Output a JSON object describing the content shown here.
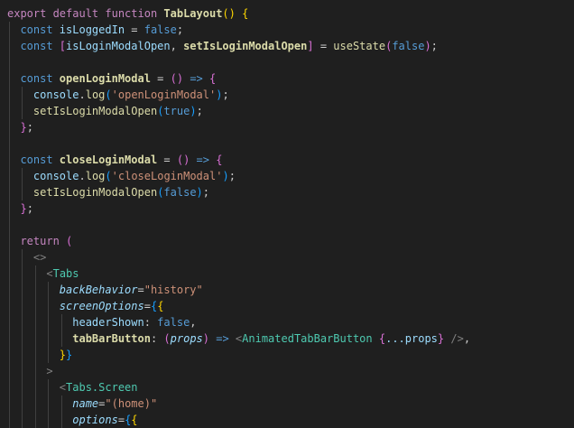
{
  "editor": {
    "theme_colors": {
      "background": "#1f1f1f",
      "keyword": "#569cd6",
      "control": "#c586c0",
      "variable": "#9cdcfe",
      "function": "#dcdcaa",
      "string": "#ce9178",
      "component": "#4ec9b0",
      "bracket_1": "#ffd700",
      "bracket_2": "#da70d6",
      "bracket_3": "#179fff"
    },
    "lines": [
      {
        "tokens": [
          {
            "t": "export default function ",
            "c": "ctl"
          },
          {
            "t": "TabLayout",
            "c": "fn bold"
          },
          {
            "t": "() ",
            "c": "br1"
          },
          {
            "t": "{",
            "c": "br1"
          }
        ]
      },
      {
        "tokens": [
          {
            "t": "  const ",
            "c": "kw"
          },
          {
            "t": "isLoggedIn",
            "c": "var"
          },
          {
            "t": " = ",
            "c": "pn"
          },
          {
            "t": "false",
            "c": "kw"
          },
          {
            "t": ";",
            "c": "pn"
          }
        ]
      },
      {
        "tokens": [
          {
            "t": "  const ",
            "c": "kw"
          },
          {
            "t": "[",
            "c": "br2"
          },
          {
            "t": "isLoginModalOpen",
            "c": "var"
          },
          {
            "t": ", ",
            "c": "pn"
          },
          {
            "t": "setIsLoginModalOpen",
            "c": "fn bold"
          },
          {
            "t": "]",
            "c": "br2"
          },
          {
            "t": " = ",
            "c": "pn"
          },
          {
            "t": "useState",
            "c": "fn"
          },
          {
            "t": "(",
            "c": "br2"
          },
          {
            "t": "false",
            "c": "kw"
          },
          {
            "t": ")",
            "c": "br2"
          },
          {
            "t": ";",
            "c": "pn"
          }
        ]
      },
      {
        "tokens": []
      },
      {
        "tokens": [
          {
            "t": "  const ",
            "c": "kw"
          },
          {
            "t": "openLoginModal",
            "c": "fn bold"
          },
          {
            "t": " = ",
            "c": "pn"
          },
          {
            "t": "()",
            "c": "br2"
          },
          {
            "t": " => ",
            "c": "kw"
          },
          {
            "t": "{",
            "c": "br2"
          }
        ]
      },
      {
        "tokens": [
          {
            "t": "    console",
            "c": "var"
          },
          {
            "t": ".",
            "c": "pn"
          },
          {
            "t": "log",
            "c": "fn"
          },
          {
            "t": "(",
            "c": "br3"
          },
          {
            "t": "'openLoginModal'",
            "c": "str"
          },
          {
            "t": ")",
            "c": "br3"
          },
          {
            "t": ";",
            "c": "pn"
          }
        ]
      },
      {
        "tokens": [
          {
            "t": "    ",
            "c": "pn"
          },
          {
            "t": "setIsLoginModalOpen",
            "c": "fn"
          },
          {
            "t": "(",
            "c": "br3"
          },
          {
            "t": "true",
            "c": "kw"
          },
          {
            "t": ")",
            "c": "br3"
          },
          {
            "t": ";",
            "c": "pn"
          }
        ]
      },
      {
        "tokens": [
          {
            "t": "  ",
            "c": "pn"
          },
          {
            "t": "}",
            "c": "br2"
          },
          {
            "t": ";",
            "c": "pn"
          }
        ]
      },
      {
        "tokens": []
      },
      {
        "tokens": [
          {
            "t": "  const ",
            "c": "kw"
          },
          {
            "t": "closeLoginModal",
            "c": "fn bold"
          },
          {
            "t": " = ",
            "c": "pn"
          },
          {
            "t": "()",
            "c": "br2"
          },
          {
            "t": " => ",
            "c": "kw"
          },
          {
            "t": "{",
            "c": "br2"
          }
        ]
      },
      {
        "tokens": [
          {
            "t": "    console",
            "c": "var"
          },
          {
            "t": ".",
            "c": "pn"
          },
          {
            "t": "log",
            "c": "fn"
          },
          {
            "t": "(",
            "c": "br3"
          },
          {
            "t": "'closeLoginModal'",
            "c": "str"
          },
          {
            "t": ")",
            "c": "br3"
          },
          {
            "t": ";",
            "c": "pn"
          }
        ]
      },
      {
        "tokens": [
          {
            "t": "    ",
            "c": "pn"
          },
          {
            "t": "setIsLoginModalOpen",
            "c": "fn"
          },
          {
            "t": "(",
            "c": "br3"
          },
          {
            "t": "false",
            "c": "kw"
          },
          {
            "t": ")",
            "c": "br3"
          },
          {
            "t": ";",
            "c": "pn"
          }
        ]
      },
      {
        "tokens": [
          {
            "t": "  ",
            "c": "pn"
          },
          {
            "t": "}",
            "c": "br2"
          },
          {
            "t": ";",
            "c": "pn"
          }
        ]
      },
      {
        "tokens": []
      },
      {
        "tokens": [
          {
            "t": "  return ",
            "c": "ctl"
          },
          {
            "t": "(",
            "c": "br2"
          }
        ]
      },
      {
        "tokens": [
          {
            "t": "    ",
            "c": "pn"
          },
          {
            "t": "<>",
            "c": "tag"
          }
        ]
      },
      {
        "tokens": [
          {
            "t": "      ",
            "c": "pn"
          },
          {
            "t": "<",
            "c": "tag"
          },
          {
            "t": "Tabs",
            "c": "tagn"
          }
        ]
      },
      {
        "tokens": [
          {
            "t": "        ",
            "c": "pn"
          },
          {
            "t": "backBehavior",
            "c": "attr"
          },
          {
            "t": "=",
            "c": "pn"
          },
          {
            "t": "\"history\"",
            "c": "str"
          }
        ]
      },
      {
        "tokens": [
          {
            "t": "        ",
            "c": "pn"
          },
          {
            "t": "screenOptions",
            "c": "attr"
          },
          {
            "t": "=",
            "c": "pn"
          },
          {
            "t": "{",
            "c": "br3"
          },
          {
            "t": "{",
            "c": "br1"
          }
        ]
      },
      {
        "tokens": [
          {
            "t": "          headerShown",
            "c": "var"
          },
          {
            "t": ": ",
            "c": "pn"
          },
          {
            "t": "false",
            "c": "kw"
          },
          {
            "t": ",",
            "c": "pn"
          }
        ]
      },
      {
        "tokens": [
          {
            "t": "          tabBarButton",
            "c": "fn bold"
          },
          {
            "t": ": ",
            "c": "pn"
          },
          {
            "t": "(",
            "c": "br2"
          },
          {
            "t": "props",
            "c": "var ital"
          },
          {
            "t": ")",
            "c": "br2"
          },
          {
            "t": " => ",
            "c": "kw"
          },
          {
            "t": "<",
            "c": "tag"
          },
          {
            "t": "AnimatedTabBarButton",
            "c": "tagn"
          },
          {
            "t": " ",
            "c": "pn"
          },
          {
            "t": "{",
            "c": "br2"
          },
          {
            "t": "...props",
            "c": "var"
          },
          {
            "t": "}",
            "c": "br2"
          },
          {
            "t": " />",
            "c": "tag"
          },
          {
            "t": ",",
            "c": "pn"
          }
        ]
      },
      {
        "tokens": [
          {
            "t": "        ",
            "c": "pn"
          },
          {
            "t": "}",
            "c": "br1"
          },
          {
            "t": "}",
            "c": "br3"
          }
        ]
      },
      {
        "tokens": [
          {
            "t": "      ",
            "c": "pn"
          },
          {
            "t": ">",
            "c": "tag"
          }
        ]
      },
      {
        "tokens": [
          {
            "t": "        ",
            "c": "pn"
          },
          {
            "t": "<",
            "c": "tag"
          },
          {
            "t": "Tabs.Screen",
            "c": "tagn"
          }
        ]
      },
      {
        "tokens": [
          {
            "t": "          ",
            "c": "pn"
          },
          {
            "t": "name",
            "c": "attr"
          },
          {
            "t": "=",
            "c": "pn"
          },
          {
            "t": "\"(home)\"",
            "c": "str"
          }
        ]
      },
      {
        "tokens": [
          {
            "t": "          ",
            "c": "pn"
          },
          {
            "t": "options",
            "c": "attr"
          },
          {
            "t": "=",
            "c": "pn"
          },
          {
            "t": "{",
            "c": "br3"
          },
          {
            "t": "{",
            "c": "br1"
          }
        ]
      }
    ]
  }
}
